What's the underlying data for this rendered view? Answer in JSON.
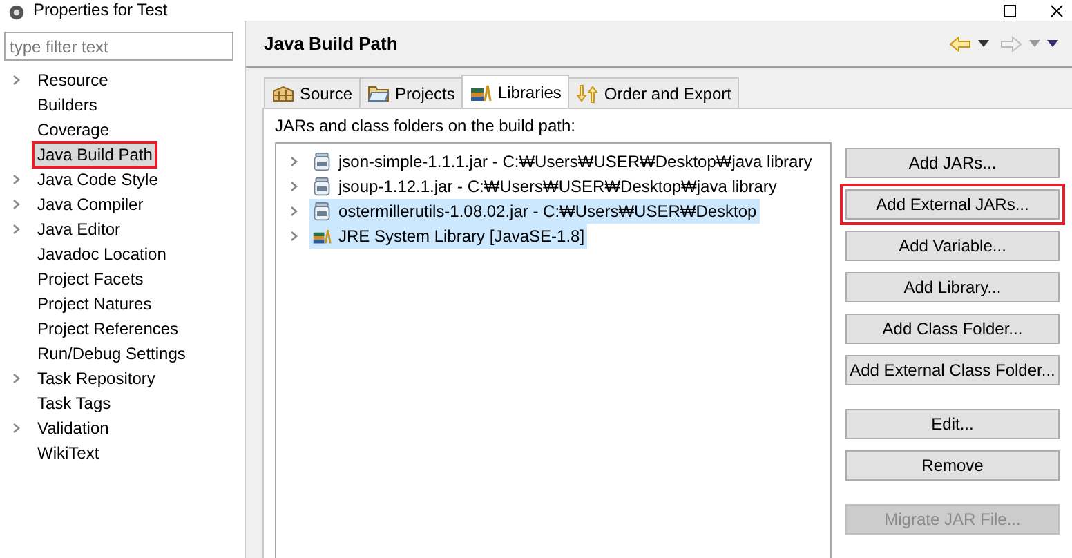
{
  "window": {
    "title": "Properties for Test"
  },
  "filter": {
    "placeholder": "type filter text"
  },
  "sidebar": {
    "items": [
      {
        "label": "Resource",
        "expandable": true,
        "selected": false,
        "highlighted": false
      },
      {
        "label": "Builders",
        "expandable": false,
        "selected": false,
        "highlighted": false
      },
      {
        "label": "Coverage",
        "expandable": false,
        "selected": false,
        "highlighted": false
      },
      {
        "label": "Java Build Path",
        "expandable": false,
        "selected": true,
        "highlighted": true
      },
      {
        "label": "Java Code Style",
        "expandable": true,
        "selected": false,
        "highlighted": false
      },
      {
        "label": "Java Compiler",
        "expandable": true,
        "selected": false,
        "highlighted": false
      },
      {
        "label": "Java Editor",
        "expandable": true,
        "selected": false,
        "highlighted": false
      },
      {
        "label": "Javadoc Location",
        "expandable": false,
        "selected": false,
        "highlighted": false
      },
      {
        "label": "Project Facets",
        "expandable": false,
        "selected": false,
        "highlighted": false
      },
      {
        "label": "Project Natures",
        "expandable": false,
        "selected": false,
        "highlighted": false
      },
      {
        "label": "Project References",
        "expandable": false,
        "selected": false,
        "highlighted": false
      },
      {
        "label": "Run/Debug Settings",
        "expandable": false,
        "selected": false,
        "highlighted": false
      },
      {
        "label": "Task Repository",
        "expandable": true,
        "selected": false,
        "highlighted": false
      },
      {
        "label": "Task Tags",
        "expandable": false,
        "selected": false,
        "highlighted": false
      },
      {
        "label": "Validation",
        "expandable": true,
        "selected": false,
        "highlighted": false
      },
      {
        "label": "WikiText",
        "expandable": false,
        "selected": false,
        "highlighted": false
      }
    ]
  },
  "page": {
    "title": "Java Build Path"
  },
  "tabs": [
    {
      "label": "Source",
      "kind": "source",
      "selected": false
    },
    {
      "label": "Projects",
      "kind": "projects",
      "selected": false
    },
    {
      "label": "Libraries",
      "kind": "libraries",
      "selected": true
    },
    {
      "label": "Order and Export",
      "kind": "order",
      "selected": false
    }
  ],
  "list_label": "JARs and class folders on the build path:",
  "entries": [
    {
      "label": "json-simple-1.1.1.jar - C:₩Users₩USER₩Desktop₩java library",
      "kind": "jar",
      "selected": false
    },
    {
      "label": "jsoup-1.12.1.jar - C:₩Users₩USER₩Desktop₩java library",
      "kind": "jar",
      "selected": false
    },
    {
      "label": "ostermillerutils-1.08.02.jar - C:₩Users₩USER₩Desktop",
      "kind": "jar",
      "selected": true
    },
    {
      "label": "JRE System Library [JavaSE-1.8]",
      "kind": "library",
      "selected": true
    }
  ],
  "button_groups": [
    [
      {
        "label": "Add JARs...",
        "disabled": false,
        "highlighted": false
      },
      {
        "label": "Add External JARs...",
        "disabled": false,
        "highlighted": true
      },
      {
        "label": "Add Variable...",
        "disabled": false,
        "highlighted": false
      },
      {
        "label": "Add Library...",
        "disabled": false,
        "highlighted": false
      },
      {
        "label": "Add Class Folder...",
        "disabled": false,
        "highlighted": false
      },
      {
        "label": "Add External Class Folder...",
        "disabled": false,
        "highlighted": false
      }
    ],
    [
      {
        "label": "Edit...",
        "disabled": false,
        "highlighted": false
      },
      {
        "label": "Remove",
        "disabled": false,
        "highlighted": false
      }
    ],
    [
      {
        "label": "Migrate JAR File...",
        "disabled": true,
        "highlighted": false
      }
    ]
  ]
}
